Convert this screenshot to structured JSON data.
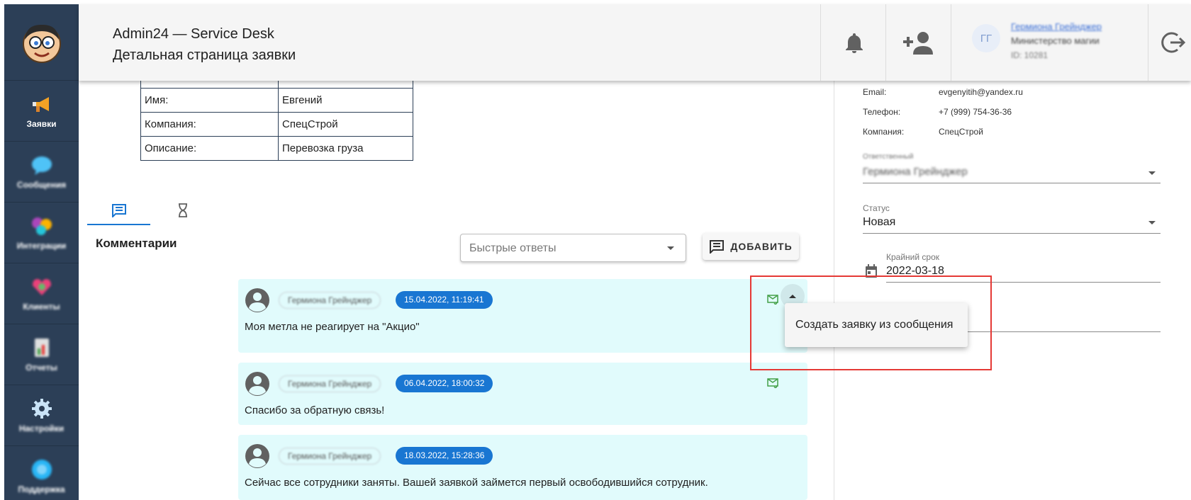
{
  "header": {
    "app_title": "Admin24 — Service Desk",
    "page_subtitle": "Детальная страница заявки",
    "avatar_initials": "ГГ",
    "user_name": "Гермиона Грейнджер",
    "user_org": "Министерство магии",
    "user_id": "ID: 10281"
  },
  "sidebar": {
    "items": [
      {
        "label": "Заявки",
        "icon": "megaphone-icon"
      },
      {
        "label": "Сообщения",
        "icon": "chat-bubble-icon"
      },
      {
        "label": "Интеграции",
        "icon": "integrations-icon"
      },
      {
        "label": "Клиенты",
        "icon": "clients-icon"
      },
      {
        "label": "Отчеты",
        "icon": "report-icon"
      },
      {
        "label": "Настройки",
        "icon": "gear-icon"
      },
      {
        "label": "Поддержка",
        "icon": "support-icon"
      }
    ]
  },
  "info_table": {
    "rows": [
      {
        "key": "Имя:",
        "value": "Евгений"
      },
      {
        "key": "Компания:",
        "value": "СпецСтрой"
      },
      {
        "key": "Описание:",
        "value": "Перевозка груза"
      }
    ]
  },
  "comments": {
    "title": "Комментарии",
    "quick_replies_placeholder": "Быстрые ответы",
    "add_label": "ДОБАВИТЬ",
    "messages": [
      {
        "author": "Гермиона Грейнджер",
        "date": "15.04.2022, 11:19:41",
        "text": "Моя метла не реагирует на \"Акцио\""
      },
      {
        "author": "Гермиона Грейнджер",
        "date": "06.04.2022, 18:00:32",
        "text": "Спасибо за обратную связь!"
      },
      {
        "author": "Гермиона Грейнджер",
        "date": "18.03.2022, 15:28:36",
        "text": "Сейчас все сотрудники заняты. Вашей заявкой займется первый освободившийся сотрудник."
      }
    ]
  },
  "popup_menu": {
    "item_label": "Создать заявку из сообщения"
  },
  "client": {
    "email_label": "Email:",
    "email": "evgenyitih@yandex.ru",
    "phone_label": "Телефон:",
    "phone": "+7 (999) 754-36-36",
    "company_label": "Компания:",
    "company": "СпецСтрой"
  },
  "ticket": {
    "assignee_label": "Ответственный",
    "assignee": "Гермиона Грейнджер",
    "status_label": "Статус",
    "status": "Новая",
    "deadline_label": "Крайний срок",
    "deadline": "2022-03-18"
  },
  "colors": {
    "sidebar": "#2c3f57",
    "accent": "#1976d2",
    "message_bg": "#e1fbfc",
    "highlight": "#e53935"
  }
}
